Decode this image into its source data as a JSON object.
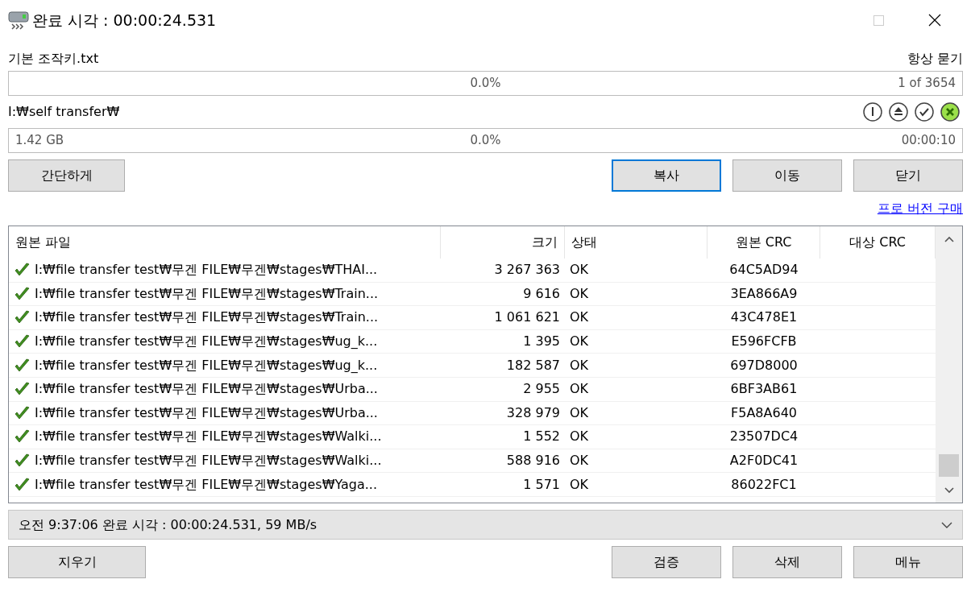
{
  "window": {
    "title": "완료 시각 : 00:00:24.531"
  },
  "file": {
    "name": "기본 조작키.txt",
    "ask": "항상 묻기",
    "progress": {
      "level": 0,
      "reading": "0.0%",
      "count": "1 of 3654"
    }
  },
  "target": {
    "path": "I:₩self transfer₩",
    "progress": {
      "level": 0,
      "size": "1.42 GB",
      "reading": "0.0%",
      "remaining": "00:00:10"
    }
  },
  "tool_icons": [
    {
      "kind": "power",
      "active": false
    },
    {
      "kind": "eject",
      "active": false
    },
    {
      "kind": "check",
      "active": false
    },
    {
      "kind": "cancel",
      "active": true
    }
  ],
  "buttons": [
    {
      "label": "간단하게",
      "default": false
    },
    {
      "label": "복사",
      "default": true
    },
    {
      "label": "이동",
      "default": false
    },
    {
      "label": "닫기",
      "default": false
    }
  ],
  "pro_link": "프로 버전 구매",
  "table": {
    "columns": [
      "원본 파일",
      "크기",
      "상태",
      "원본 CRC",
      "대상 CRC"
    ],
    "rows": [
      {
        "file": "I:₩file transfer test₩무겐 FILE₩무겐₩stages₩THAI...",
        "size": "3 267 363",
        "status": "OK",
        "src_crc": "64C5AD94"
      },
      {
        "file": "I:₩file transfer test₩무겐 FILE₩무겐₩stages₩Train...",
        "size": "9 616",
        "status": "OK",
        "src_crc": "3EA866A9"
      },
      {
        "file": "I:₩file transfer test₩무겐 FILE₩무겐₩stages₩Train...",
        "size": "1 061 621",
        "status": "OK",
        "src_crc": "43C478E1"
      },
      {
        "file": "I:₩file transfer test₩무겐 FILE₩무겐₩stages₩ug_k...",
        "size": "1 395",
        "status": "OK",
        "src_crc": "E596FCFB"
      },
      {
        "file": "I:₩file transfer test₩무겐 FILE₩무겐₩stages₩ug_k...",
        "size": "182 587",
        "status": "OK",
        "src_crc": "697D8000"
      },
      {
        "file": "I:₩file transfer test₩무겐 FILE₩무겐₩stages₩Urba...",
        "size": "2 955",
        "status": "OK",
        "src_crc": "6BF3AB61"
      },
      {
        "file": "I:₩file transfer test₩무겐 FILE₩무겐₩stages₩Urba...",
        "size": "328 979",
        "status": "OK",
        "src_crc": "F5A8A640"
      },
      {
        "file": "I:₩file transfer test₩무겐 FILE₩무겐₩stages₩Walki...",
        "size": "1 552",
        "status": "OK",
        "src_crc": "23507DC4"
      },
      {
        "file": "I:₩file transfer test₩무겐 FILE₩무겐₩stages₩Walki...",
        "size": "588 916",
        "status": "OK",
        "src_crc": "A2F0DC41"
      },
      {
        "file": "I:₩file transfer test₩무겐 FILE₩무겐₩stages₩Yaga...",
        "size": "1 571",
        "status": "OK",
        "src_crc": "86022FC1"
      }
    ]
  },
  "status_bar": "오전 9:37:06 완료 시각 : 00:00:24.531, 59 MB/s",
  "bottom_buttons": [
    "지우기",
    "검증",
    "삭제",
    "메뉴"
  ]
}
